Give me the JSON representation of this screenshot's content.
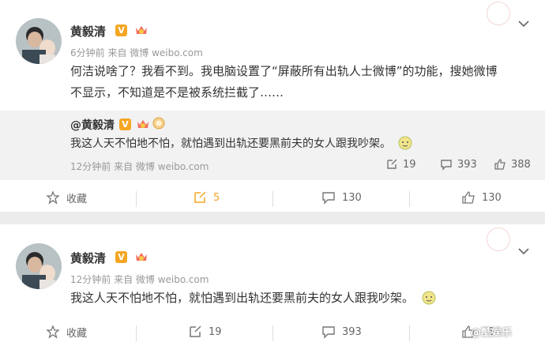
{
  "post1": {
    "author": "黄毅清",
    "meta": "6分钟前  来自 微博 weibo.com",
    "text_line1": "何洁说啥了？我看不到。我电脑设置了“屏蔽所有出轨人士微博”的功能，搜她微博",
    "text_line2": "不显示，不知道是不是被系统拦截了……",
    "quoted": {
      "author": "@黄毅清",
      "text": "我这人天不怕地不怕，就怕遇到出轨还要黑前夫的女人跟我吵架。",
      "meta": "12分钟前  来自 微博 weibo.com",
      "reposts": "19",
      "comments": "393",
      "likes": "388"
    },
    "actions": {
      "favorite": "收藏",
      "repost": "5",
      "comment": "130",
      "like": "130"
    }
  },
  "post2": {
    "author": "黄毅清",
    "meta": "12分钟前  来自 微博 weibo.com",
    "text": "我这人天不怕地不怕，就怕遇到出轨还要黑前夫的女人跟我吵架。",
    "actions": {
      "favorite": "收藏",
      "repost": "19",
      "comment": "393",
      "like": "388"
    }
  },
  "watermark": "@酷娱乐",
  "colors": {
    "accent_orange": "#f5a623",
    "repost_bg": "#f2f2f2",
    "page_bg": "#ececec"
  }
}
